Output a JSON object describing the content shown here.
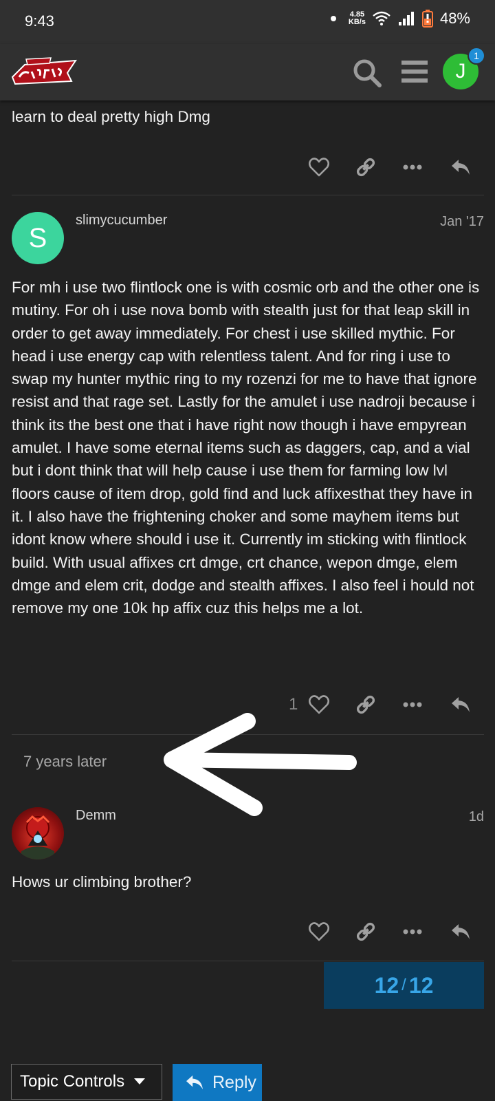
{
  "status_bar": {
    "time": "9:43",
    "net_speed_value": "4.85",
    "net_speed_unit": "KB/s",
    "battery": "48%"
  },
  "header": {
    "logo_text": "Dungeon Quest!",
    "notification_count": "1",
    "user_initial": "J"
  },
  "posts": [
    {
      "text": "learn to deal pretty high Dmg",
      "likes": ""
    },
    {
      "username": "slimycucumber",
      "avatar_letter": "S",
      "avatar_color": "#3cd59d",
      "date": "Jan '17",
      "text": "For mh i use two flintlock one is with cosmic orb and the other one is mutiny. For oh i use nova bomb with stealth just for that leap skill in order to get away immediately. For chest i use skilled mythic. For head i use energy cap with relentless talent. And for ring i use to swap my hunter mythic ring to my rozenzi for me to have that ignore resist and that rage set. Lastly for the amulet i use nadroji because i think its the best one that i have right now though i have empyrean amulet. I have some eternal items such as daggers, cap, and a vial but i dont think that will help cause i use them for farming low lvl floors cause of item drop, gold find and luck affixesthat they have in it. I also have the frightening choker and some mayhem items but idont know where should i use it. Currently im sticking with flintlock build. With usual affixes crt dmge, crt chance, wepon dmge, elem dmge and elem crit, dodge and stealth affixes. I also feel i hould not remove my one 10k hp affix cuz this helps me a lot.",
      "likes": "1"
    },
    {
      "username": "Demm",
      "date": "1d",
      "text": "Hows ur climbing brother?",
      "likes": ""
    }
  ],
  "time_gap": "7 years later",
  "progress": {
    "current": "12",
    "separator": "/",
    "total": "12"
  },
  "footer": {
    "topic_controls_label": "Topic Controls",
    "reply_label": "Reply"
  },
  "colors": {
    "background": "#222222",
    "header": "#303030",
    "accent": "#0f78c2",
    "progress_bg": "#0a3d5e",
    "user_avatar": "#2ebd36"
  }
}
